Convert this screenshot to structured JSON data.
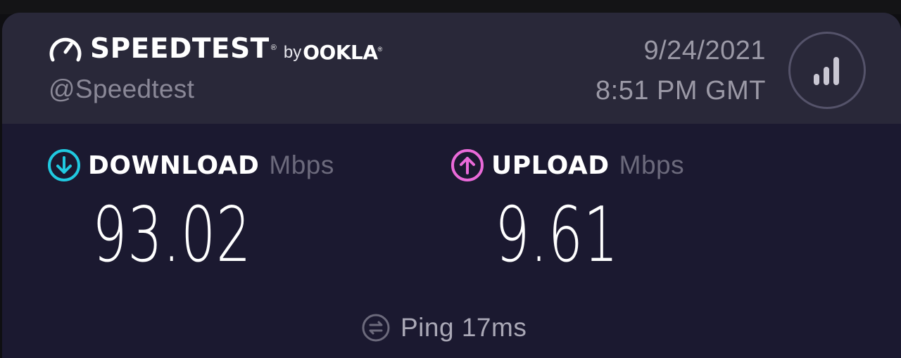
{
  "brand": {
    "name": "SPEEDTEST",
    "by": "by",
    "partner": "OOKLA",
    "handle": "@Speedtest",
    "gauge_icon": "gauge-icon"
  },
  "timestamp": {
    "date": "9/24/2021",
    "time": "8:51 PM GMT"
  },
  "results_button": {
    "icon": "bar-chart-icon"
  },
  "download": {
    "label": "DOWNLOAD",
    "unit": "Mbps",
    "value": "93.02",
    "icon": "arrow-down-circle-icon",
    "color": "#20c9e0"
  },
  "upload": {
    "label": "UPLOAD",
    "unit": "Mbps",
    "value": "9.61",
    "icon": "arrow-up-circle-icon",
    "color": "#ea6ad9"
  },
  "ping": {
    "label": "Ping",
    "value": "17ms",
    "icon": "ping-icon"
  },
  "colors": {
    "card_background": "#1b1930",
    "header_background": "#292839"
  }
}
